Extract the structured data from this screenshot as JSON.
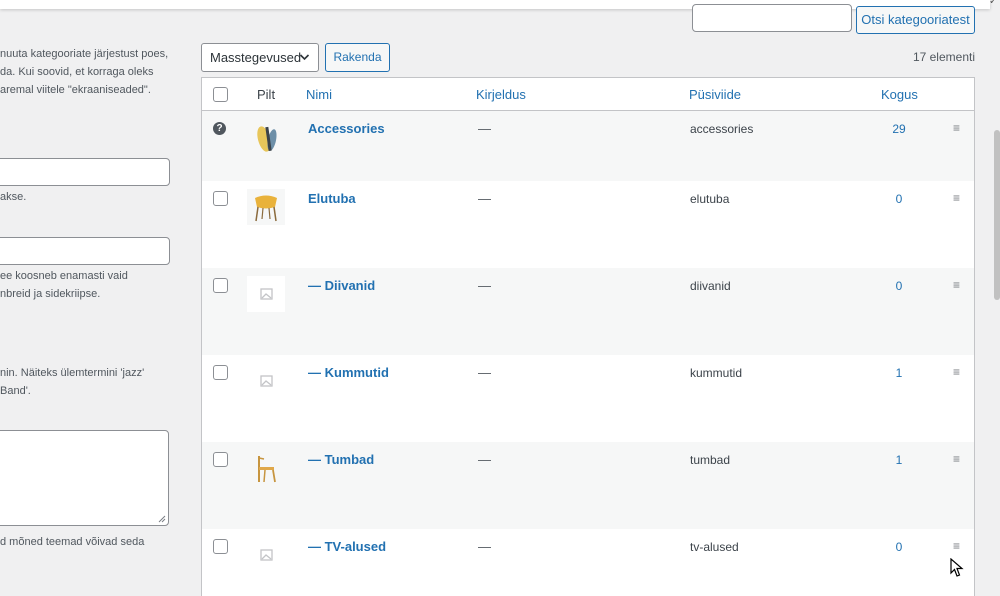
{
  "search": {
    "placeholder": "",
    "button_label": "Otsi kategooriatest"
  },
  "left_form": {
    "intro_lines": [
      "nuuta kategooriate järjestust poes,",
      "da. Kui soovid, et korraga oleks",
      "aremal viitele \"ekraaniseaded\"."
    ],
    "name_help": "akse.",
    "slug_help_lines": [
      "ee koosneb enamasti vaid",
      "nbreid ja sidekriipse."
    ],
    "parent_help_lines": [
      "nin. Näiteks ülemtermini 'jazz'",
      "Band'."
    ],
    "desc_help": "d mõned teemad võivad seda"
  },
  "controls": {
    "bulk_action": "Masstegevused",
    "apply_label": "Rakenda",
    "items_count": "17 elementi"
  },
  "table": {
    "headers": {
      "image": "Pilt",
      "name": "Nimi",
      "description": "Kirjeldus",
      "slug": "Püsiviide",
      "count": "Kogus"
    },
    "rows": [
      {
        "name": "Accessories",
        "description": "—",
        "slug": "accessories",
        "count": "29",
        "thumb": "accessories-image"
      },
      {
        "name": "Elutuba",
        "description": "—",
        "slug": "elutuba",
        "count": "0",
        "thumb": "yellow-chair-image"
      },
      {
        "name": "— Diivanid",
        "description": "—",
        "slug": "diivanid",
        "count": "0",
        "thumb": "placeholder-image"
      },
      {
        "name": "— Kummutid",
        "description": "—",
        "slug": "kummutid",
        "count": "1",
        "thumb": "placeholder-image"
      },
      {
        "name": "— Tumbad",
        "description": "—",
        "slug": "tumbad",
        "count": "1",
        "thumb": "wooden-chair-image"
      },
      {
        "name": "— TV-alused",
        "description": "—",
        "slug": "tv-alused",
        "count": "0",
        "thumb": "placeholder-image"
      }
    ]
  },
  "colors": {
    "link": "#2271b1",
    "background": "#f0f0f1",
    "stripe": "#f6f7f7"
  }
}
